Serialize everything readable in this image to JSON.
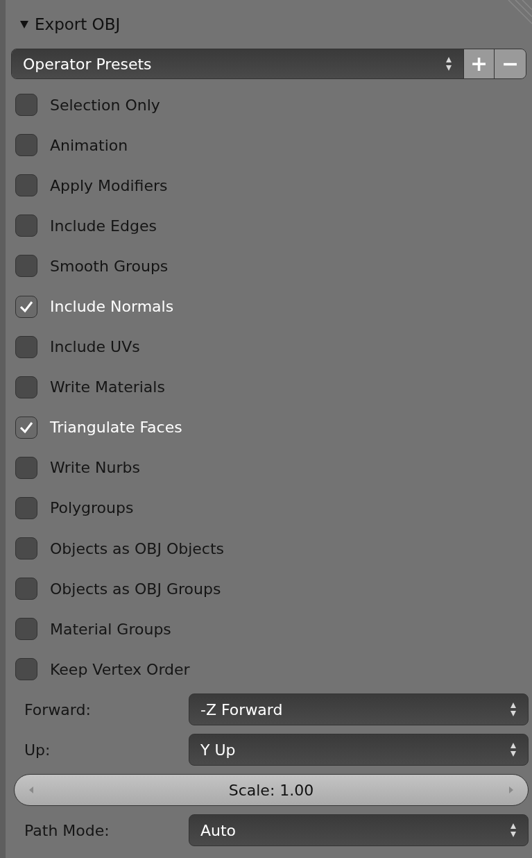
{
  "panel": {
    "title": "Export OBJ",
    "expanded": true
  },
  "presets": {
    "value": "Operator Presets",
    "add": "+",
    "remove": "−"
  },
  "options": [
    {
      "label": "Selection Only",
      "checked": false
    },
    {
      "label": "Animation",
      "checked": false
    },
    {
      "label": "Apply Modifiers",
      "checked": false
    },
    {
      "label": "Include Edges",
      "checked": false
    },
    {
      "label": "Smooth Groups",
      "checked": false
    },
    {
      "label": "Include Normals",
      "checked": true
    },
    {
      "label": "Include UVs",
      "checked": false
    },
    {
      "label": "Write Materials",
      "checked": false
    },
    {
      "label": "Triangulate Faces",
      "checked": true
    },
    {
      "label": "Write Nurbs",
      "checked": false
    },
    {
      "label": "Polygroups",
      "checked": false
    },
    {
      "label": "Objects as OBJ Objects",
      "checked": false
    },
    {
      "label": "Objects as OBJ Groups",
      "checked": false
    },
    {
      "label": "Material Groups",
      "checked": false
    },
    {
      "label": "Keep Vertex Order",
      "checked": false
    }
  ],
  "settings": [
    {
      "kind": "select",
      "label": "Forward:",
      "value": "-Z Forward"
    },
    {
      "kind": "select",
      "label": "Up:",
      "value": "Y Up"
    },
    {
      "kind": "number",
      "value": "Scale: 1.00"
    },
    {
      "kind": "select",
      "label": "Path Mode:",
      "value": "Auto"
    }
  ]
}
